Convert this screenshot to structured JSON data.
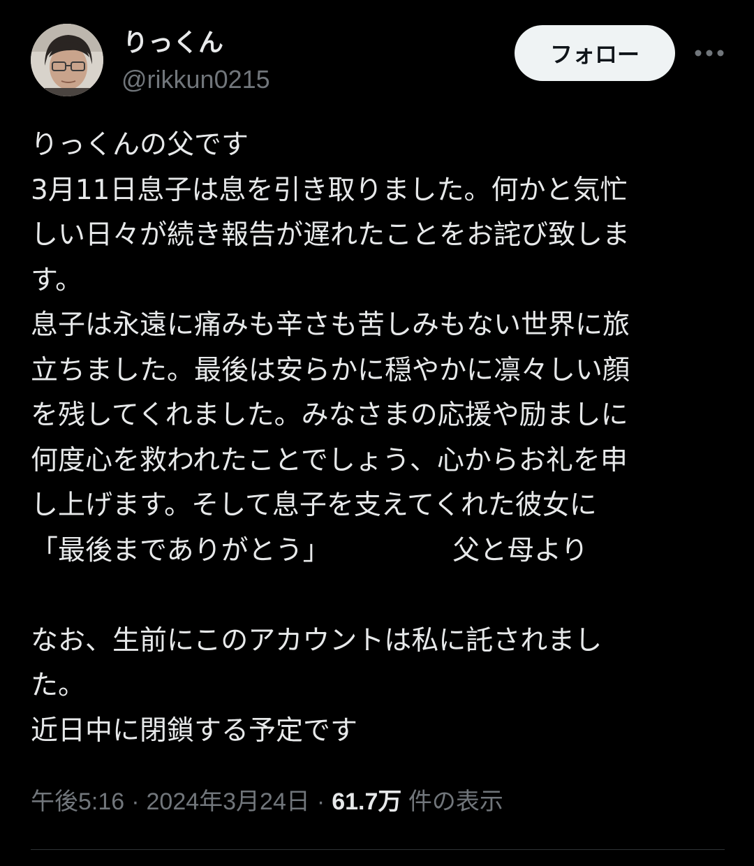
{
  "profile": {
    "display_name": "りっくん",
    "handle": "@rikkun0215",
    "avatar_icon": "avatar-photo"
  },
  "actions": {
    "follow_label": "フォロー",
    "more_icon": "more-dots-icon"
  },
  "tweet": {
    "lines": [
      "りっくんの父です",
      "3月11日息子は息を引き取りました。何かと気忙",
      "しい日々が続き報告が遅れたことをお詫び致しま",
      "す。",
      "息子は永遠に痛みも辛さも苦しみもない世界に旅",
      "立ちました。最後は安らかに穏やかに凛々しい顔",
      "を残してくれました。みなさまの応援や励ましに",
      "何度心を救われたことでしょう、心からお礼を申",
      "し上げます。そして息子を支えてくれた彼女に",
      "「最後までありがとう」　　　　　父と母より",
      "",
      "なお、生前にこのアカウントは私に託されまし",
      "た。",
      "近日中に閉鎖する予定です"
    ]
  },
  "meta": {
    "time": "午後5:16",
    "date": "2024年3月24日",
    "views_count": "61.7万",
    "views_label": "件の表示",
    "separator": "·"
  },
  "colors": {
    "background": "#000000",
    "text_primary": "#e7e9ea",
    "text_secondary": "#71767b",
    "follow_button_bg": "#eff3f4",
    "divider": "#2f3336"
  }
}
